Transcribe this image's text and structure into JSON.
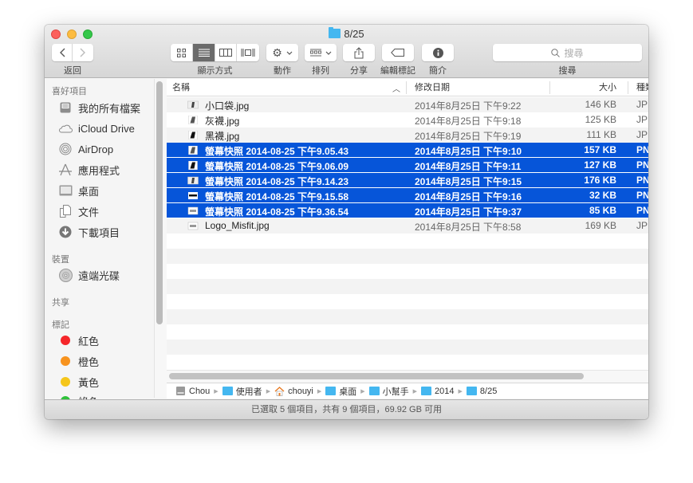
{
  "window": {
    "title": "8/25",
    "title_icon": "folder-icon"
  },
  "toolbar": {
    "back_label": "返回",
    "view_label": "顯示方式",
    "action_label": "動作",
    "arrange_label": "排列",
    "share_label": "分享",
    "tags_label": "編輯標記",
    "info_label": "簡介",
    "search_label": "搜尋",
    "search_placeholder": "搜尋",
    "view_modes": [
      "icon-view",
      "list-view",
      "column-view",
      "coverflow-view"
    ],
    "active_view": "list-view"
  },
  "sidebar": {
    "sections": [
      {
        "header": "喜好項目",
        "items": [
          {
            "label": "我的所有檔案",
            "icon": "all-files-icon"
          },
          {
            "label": "iCloud Drive",
            "icon": "cloud-icon"
          },
          {
            "label": "AirDrop",
            "icon": "airdrop-icon"
          },
          {
            "label": "應用程式",
            "icon": "applications-icon"
          },
          {
            "label": "桌面",
            "icon": "desktop-icon"
          },
          {
            "label": "文件",
            "icon": "documents-icon"
          },
          {
            "label": "下載項目",
            "icon": "downloads-icon"
          }
        ]
      },
      {
        "header": "裝置",
        "items": [
          {
            "label": "遠端光碟",
            "icon": "disc-icon"
          }
        ]
      },
      {
        "header": "共享",
        "items": []
      },
      {
        "header": "標記",
        "items": [
          {
            "label": "紅色",
            "color": "#f5262a"
          },
          {
            "label": "橙色",
            "color": "#f7931e"
          },
          {
            "label": "黃色",
            "color": "#f5c61a"
          },
          {
            "label": "綠色",
            "color": "#2fc23a"
          }
        ]
      }
    ]
  },
  "columns": {
    "name": "名稱",
    "date": "修改日期",
    "size": "大小",
    "kind": "種類",
    "sort_indicator": "^"
  },
  "files": [
    {
      "name": "小口袋.jpg",
      "date": "2014年8月25日 下午9:22",
      "size": "146 KB",
      "kind": "JPEG",
      "selected": false
    },
    {
      "name": "灰襪.jpg",
      "date": "2014年8月25日 下午9:18",
      "size": "125 KB",
      "kind": "JPEG",
      "selected": false
    },
    {
      "name": "黑襪.jpg",
      "date": "2014年8月25日 下午9:19",
      "size": "111 KB",
      "kind": "JPEG",
      "selected": false
    },
    {
      "name": "螢幕快照 2014-08-25 下午9.05.43",
      "date": "2014年8月25日 下午9:10",
      "size": "157 KB",
      "kind": "PNG",
      "selected": true
    },
    {
      "name": "螢幕快照 2014-08-25 下午9.06.09",
      "date": "2014年8月25日 下午9:11",
      "size": "127 KB",
      "kind": "PNG",
      "selected": true
    },
    {
      "name": "螢幕快照 2014-08-25 下午9.14.23",
      "date": "2014年8月25日 下午9:15",
      "size": "176 KB",
      "kind": "PNG",
      "selected": true
    },
    {
      "name": "螢幕快照 2014-08-25 下午9.15.58",
      "date": "2014年8月25日 下午9:16",
      "size": "32 KB",
      "kind": "PNG",
      "selected": true
    },
    {
      "name": "螢幕快照 2014-08-25 下午9.36.54",
      "date": "2014年8月25日 下午9:37",
      "size": "85 KB",
      "kind": "PNG",
      "selected": true
    },
    {
      "name": "Logo_Misfit.jpg",
      "date": "2014年8月25日 下午8:58",
      "size": "169 KB",
      "kind": "JPEG",
      "selected": false
    }
  ],
  "path_bar": [
    {
      "label": "Chou",
      "icon": "hard-drive-icon"
    },
    {
      "label": "使用者",
      "icon": "users-folder-icon"
    },
    {
      "label": "chouyi",
      "icon": "home-icon"
    },
    {
      "label": "桌面",
      "icon": "desktop-folder-icon"
    },
    {
      "label": "小幫手",
      "icon": "folder-icon"
    },
    {
      "label": "2014",
      "icon": "folder-icon"
    },
    {
      "label": "8/25",
      "icon": "folder-icon"
    }
  ],
  "status": "已選取 5 個項目，共有 9 個項目，69.92 GB 可用"
}
